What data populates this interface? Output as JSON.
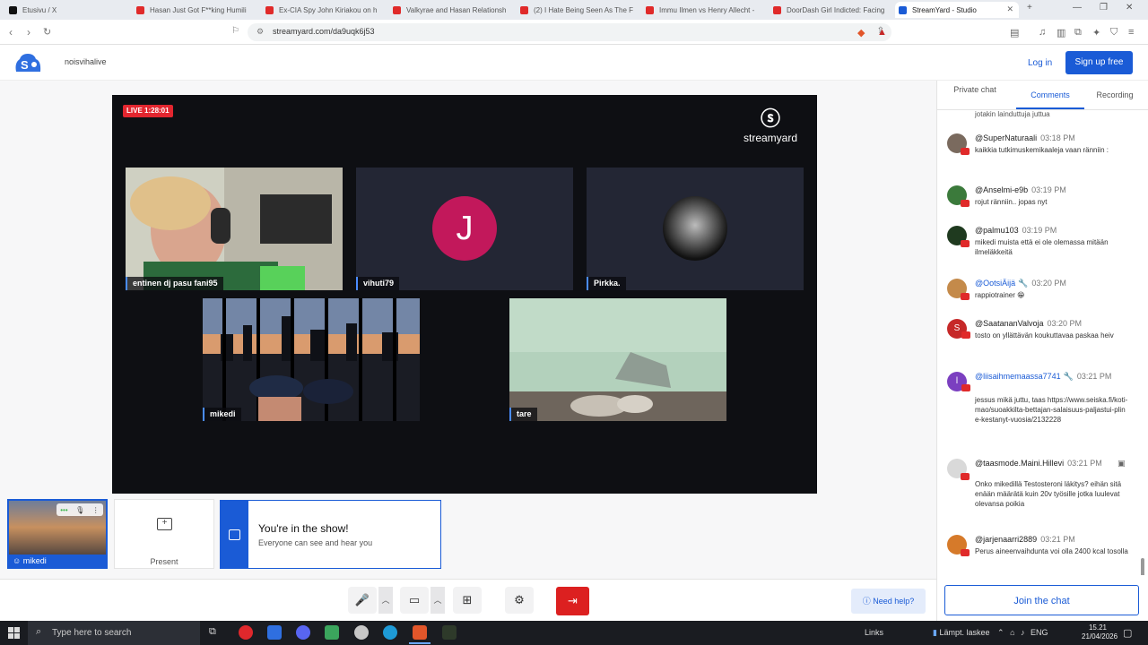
{
  "browser": {
    "tabs": [
      {
        "label": "Etusivu / X",
        "favicon_color": "#111111"
      },
      {
        "label": "Hasan Just Got F**king Humili",
        "favicon_color": "#e02a2a"
      },
      {
        "label": "Ex-CIA Spy John Kiriakou on h",
        "favicon_color": "#e02a2a"
      },
      {
        "label": "Valkyrae and Hasan Relationsh",
        "favicon_color": "#e02a2a"
      },
      {
        "label": "(2) I Hate Being Seen As The F",
        "favicon_color": "#e02a2a"
      },
      {
        "label": "Immu Ilmen vs Henry Allecht -",
        "favicon_color": "#e02a2a"
      },
      {
        "label": "DoorDash Girl Indicted: Facing",
        "favicon_color": "#e02a2a"
      },
      {
        "label": "StreamYard - Studio",
        "favicon_color": "#1a5bd6",
        "active": true
      }
    ],
    "url": "streamyard.com/da9uqk6j53",
    "new_tab": "+",
    "minimize": "—",
    "restore": "❐",
    "close": "✕"
  },
  "app": {
    "host_name": "noisvihalive",
    "login_label": "Log in",
    "signup_label": "Sign up free"
  },
  "stage": {
    "live_label": "LIVE 1:28:01",
    "brand_name": "streamyard",
    "participants": [
      {
        "name": "entinen dj pasu fani95"
      },
      {
        "name": "vihuti79",
        "avatar_letter": "J",
        "avatar_color": "#c2185b"
      },
      {
        "name": "Pirkka."
      },
      {
        "name": "mikedi"
      },
      {
        "name": "tare"
      }
    ]
  },
  "bottom": {
    "self_name": "mikedi",
    "present_label": "Present",
    "show_title": "You're in the show!",
    "show_sub": "Everyone can see and hear you",
    "help_label": "Need help?"
  },
  "chat": {
    "tabs": [
      {
        "label": "Private chat"
      },
      {
        "label": "Comments",
        "active": true
      },
      {
        "label": "Recording"
      }
    ],
    "partial_top": "jotakin lainduttuja juttua",
    "messages": [
      {
        "user": "@SuperNaturaali",
        "time": "03:18 PM",
        "text": "kaikkia tutkimuskemikaaleja vaan ränniin :",
        "avatar_color": "#7a6a5e"
      },
      {
        "user": "@Anselmi-e9b",
        "time": "03:19 PM",
        "text": "rojut ränniin.. jopas nyt",
        "avatar_color": "#3b7a3b"
      },
      {
        "user": "@palmu103",
        "time": "03:19 PM",
        "text": "mikedi muista että ei ole olemassa mitään ilmeläkkeitä",
        "avatar_color": "#1f3a1f"
      },
      {
        "user": "@OotsiÄijä",
        "time": "03:20 PM",
        "text": "rappiotrainer 😁",
        "avatar_color": "#c48a4a",
        "user_color": "#1a5bd6"
      },
      {
        "user": "@SaatananValvoja",
        "time": "03:20 PM",
        "text": "tosto on yllättävän koukuttavaa paskaa heiv",
        "avatar_color": "#c62828",
        "avatar_letter": "S"
      },
      {
        "user": "@liisaihmemaassa7741",
        "time": "03:21 PM",
        "text": "jessus mikä juttu, taas https://www.seiska.fi/koti-mao/suoakkilta-bettajan-salaisuus-paljastui-pline-kestanyt-vuosia/2132228",
        "avatar_color": "#7b3fc0",
        "avatar_letter": "l",
        "user_color": "#1a5bd6"
      },
      {
        "user": "@taasmode.Maini.Hillevi",
        "time": "03:21 PM",
        "text": "Onko mikedillä Testosteroni läkitys? eihän sitä enään määrätä kuin 20v työsille jotka luulevat olevansa poikia",
        "avatar_color": "#d9d9d9"
      },
      {
        "user": "@jarjenaarri2889",
        "time": "03:21 PM",
        "text": "Perus aineenvaihdunta voi olla 2400 kcal tosolla",
        "avatar_color": "#d67a2a"
      }
    ],
    "join_label": "Join the chat"
  },
  "taskbar": {
    "search_placeholder": "Type here to search",
    "links_label": "Links",
    "weather": "Lämpt. laskee",
    "lang": "ENG",
    "time": "15.21",
    "date": "21/04/2026"
  }
}
